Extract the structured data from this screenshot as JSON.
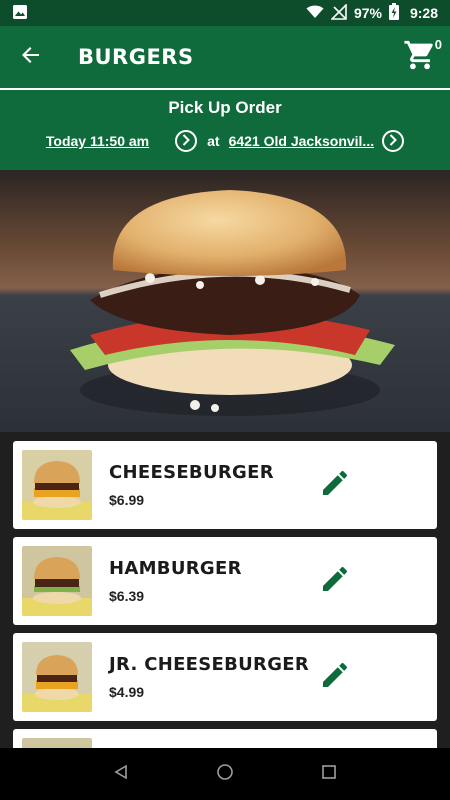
{
  "status_bar": {
    "battery": "97%",
    "time": "9:28",
    "icons": [
      "image-icon",
      "wifi-icon",
      "no-signal-icon",
      "battery-charging-icon"
    ]
  },
  "app_bar": {
    "title": "BURGERS",
    "cart_count": "0",
    "back_icon": "arrow-left-icon",
    "cart_icon": "cart-icon"
  },
  "order": {
    "title": "Pick Up Order",
    "time": "Today 11:50 am",
    "at": "at",
    "location": "6421 Old Jacksonvil..."
  },
  "menu_items": [
    {
      "name": "CHEESEBURGER",
      "price": "$6.99"
    },
    {
      "name": "HAMBURGER",
      "price": "$6.39"
    },
    {
      "name": "JR. CHEESEBURGER",
      "price": "$4.99"
    }
  ],
  "colors": {
    "brand_green": "#0f6b3c",
    "status_green": "#0d4d2b",
    "edit_green": "#0f6b3c"
  }
}
